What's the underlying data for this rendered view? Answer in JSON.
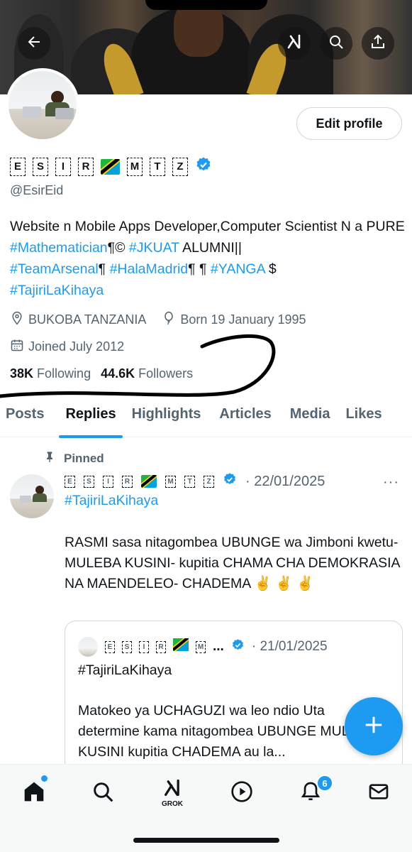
{
  "header": {
    "back_icon": "arrow-left-icon",
    "grok_icon": "grok-icon",
    "search_icon": "search-icon",
    "share_icon": "share-icon"
  },
  "profile": {
    "edit_label": "Edit profile",
    "name_glyphs": [
      "E",
      "S",
      "I",
      "R",
      "M",
      "T",
      "Z"
    ],
    "handle": "@EsirEid",
    "bio": {
      "text1": "Website n Mobile Apps Developer,Computer Scientist N a PURE ",
      "tag1": "#Mathematician",
      "text2": "¶© ",
      "tag2": "#JKUAT",
      "text3": " ALUMNI||",
      "tag3": "#TeamArsenal",
      "text4": "¶ ",
      "tag4": "#HalaMadrid",
      "text5": "¶ ¶ ",
      "tag5": "#YANGA",
      "text6": " $",
      "tag6": "#TajiriLaKihaya"
    },
    "location": "BUKOBA TANZANIA",
    "born": "Born 19 January 1995",
    "joined": "Joined July 2012",
    "following_count": "38K",
    "following_label": "Following",
    "followers_count": "44.6K",
    "followers_label": "Followers"
  },
  "tabs": [
    "Posts",
    "Replies",
    "Highlights",
    "Articles",
    "Media",
    "Likes"
  ],
  "active_tab": "Replies",
  "post": {
    "pinned_label": "Pinned",
    "date": "22/01/2025",
    "more": "···",
    "hashtag": "#TajiriLaKihaya",
    "text": "RASMI sasa nitagombea UBUNGE wa Jimboni kwetu-MULEBA KUSINI- kupitia CHAMA CHA DEMOKRASIA NA MAENDELEO- CHADEMA ✌️ ✌️ ✌️",
    "quote": {
      "date": "21/01/2025",
      "ellipsis": "...",
      "hashtag": "#TajiriLaKihaya",
      "text": "Matokeo ya UCHAGUZI wa leo ndio Uta determine kama nitagombea UBUNGE MULEBA KUSINI kupitia CHADEMA au la..."
    }
  },
  "nav": {
    "grok_label": "GROK",
    "notifications_badge": "6"
  },
  "colors": {
    "accent": "#1d9bf0",
    "text": "#0f1419",
    "muted": "#536471"
  }
}
